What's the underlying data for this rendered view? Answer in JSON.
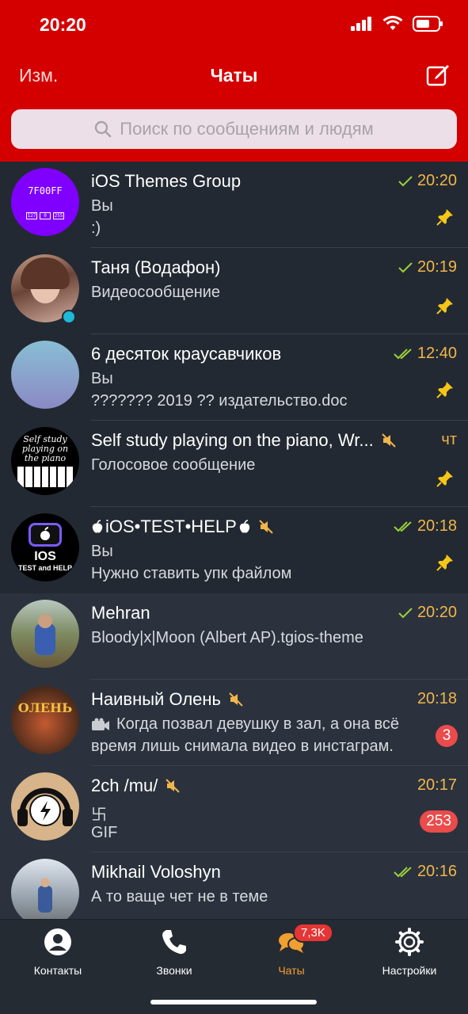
{
  "status": {
    "time": "20:20"
  },
  "nav": {
    "edit": "Изм.",
    "title": "Чаты"
  },
  "search": {
    "placeholder": "Поиск по сообщениям и людям"
  },
  "chats": [
    {
      "name": "iOS Themes Group",
      "line1": "Вы",
      "line2": ":)",
      "time": "20:20",
      "avatar_text": "7F00FF",
      "avatar_sub": [
        "127",
        "0",
        "255"
      ]
    },
    {
      "name": "Таня (Водафон)",
      "line1": "Видеосообщение",
      "line2": "",
      "time": "20:19"
    },
    {
      "name": "6 десяток краусавчиков",
      "line1": "Вы",
      "line2": "??????? 2019 ??  издательство.doc",
      "time": "12:40"
    },
    {
      "name": "Self study playing on the piano, Wr...",
      "line1": "Голосовое сообщение",
      "line2": "",
      "time": "чт",
      "avatar_text": "Self study playing on the piano"
    },
    {
      "name": "iOS•TEST•HELP",
      "line1": "Вы",
      "line2": "Нужно ставить упк файлом",
      "time": "20:18",
      "avatar_text": "IOS",
      "avatar_sub": "TEST and HELP"
    },
    {
      "name": "Mehran",
      "line1": "Bloody|x|Moon (Albert AP).tgios-theme",
      "line2": "",
      "time": "20:20"
    },
    {
      "name": "Наивный Олень",
      "line1": "Когда позвал девушку в зал, а она всё",
      "line2": "время лишь снимала видео в инстаграм.",
      "time": "20:18",
      "badge": "3"
    },
    {
      "name": "2ch /mu/",
      "line1": "卐",
      "line2": "GIF",
      "time": "20:17",
      "badge": "253"
    },
    {
      "name": "Mikhail Voloshyn",
      "line1": "А то ваще чет не в теме",
      "line2": "",
      "time": "20:16"
    }
  ],
  "tabs": {
    "contacts": "Контакты",
    "calls": "Звонки",
    "chats": "Чаты",
    "chats_badge": "7,3K",
    "settings": "Настройки"
  },
  "colors": {
    "header": "#d40000",
    "accent": "#f0b64a",
    "check": "#9bd13a",
    "badge": "#ea4b4b"
  }
}
